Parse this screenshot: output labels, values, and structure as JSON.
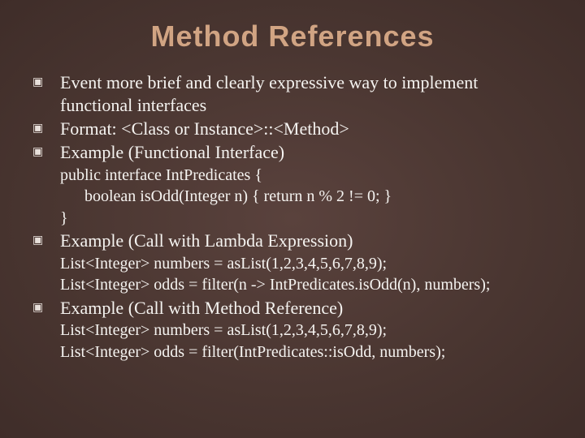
{
  "title": "Method References",
  "b1": "Event more brief and clearly expressive way to implement functional interfaces",
  "b2": "Format: <Class or Instance>::<Method>",
  "b3": "Example (Functional Interface)",
  "b3_l1": "public interface IntPredicates {",
  "b3_l2": "boolean isOdd(Integer n) { return n % 2 != 0; }",
  "b3_l3": "}",
  "b4": "Example (Call with Lambda Expression)",
  "b4_l1": "List<Integer> numbers = asList(1,2,3,4,5,6,7,8,9);",
  "b4_l2": "List<Integer> odds = filter(n -> IntPredicates.isOdd(n), numbers);",
  "b5": "Example (Call with Method Reference)",
  "b5_l1": "List<Integer> numbers = asList(1,2,3,4,5,6,7,8,9);",
  "b5_l2": "List<Integer> odds = filter(IntPredicates::isOdd,  numbers);"
}
